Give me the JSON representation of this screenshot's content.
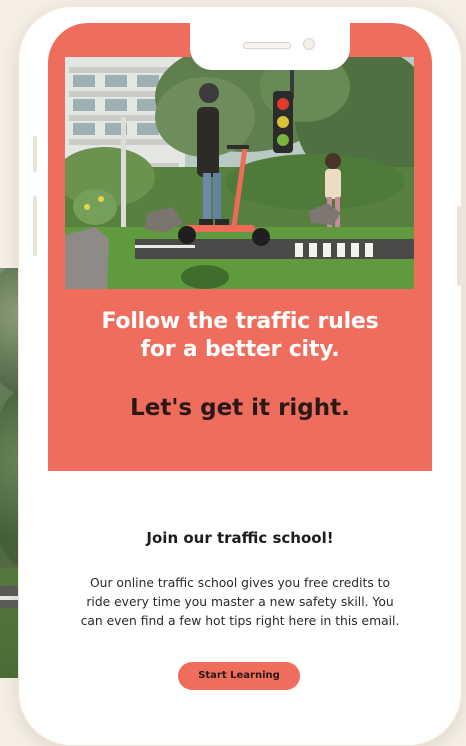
{
  "hero": {
    "image_alt_icon": "scooter-scene-illustration",
    "heading_line1": "Follow the traffic rules",
    "heading_line2": "for a better city.",
    "subheading": "Let's get it right."
  },
  "content": {
    "title": "Join our traffic school!",
    "body_line1": "Our online traffic school gives you free credits to",
    "body_line2": "ride every time you master a new safety skill. You",
    "body_line3": "can even find a few hot tips right here in this email."
  },
  "cta": {
    "label": "Start Learning"
  },
  "colors": {
    "accent": "#ef6d5c",
    "heading_dark": "#2a1816",
    "background": "#f6efe6"
  }
}
